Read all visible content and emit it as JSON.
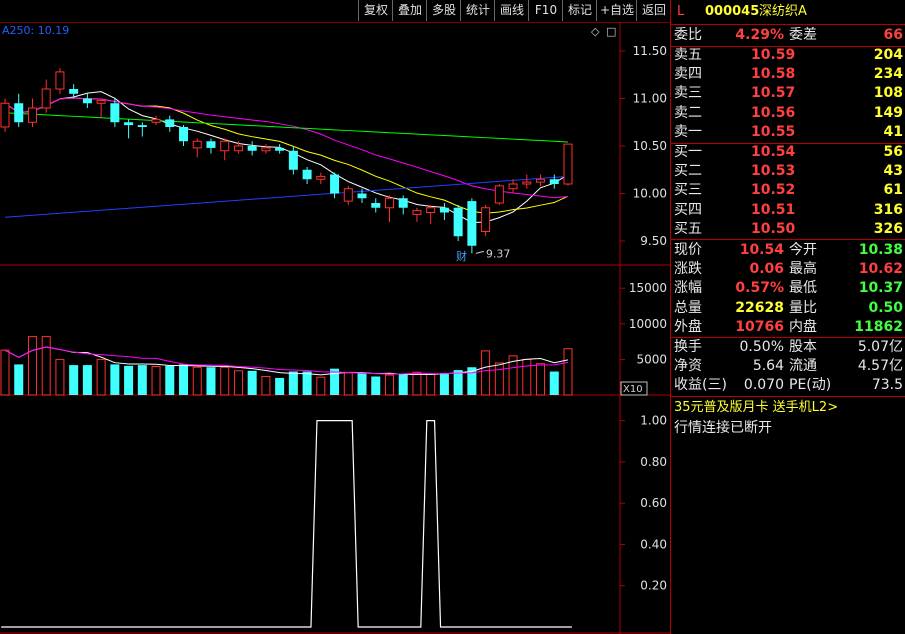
{
  "toolbar": {
    "buttons": [
      "复权",
      "叠加",
      "多股",
      "统计",
      "画线",
      "F10",
      "标记",
      "+自选",
      "返回"
    ]
  },
  "chart": {
    "ma_label": "A250: 10.19",
    "diamond_icon": "◇",
    "square_icon": "□",
    "price_ticks": [
      "11.50",
      "11.00",
      "10.50",
      "10.00",
      "9.50"
    ],
    "volume_ticks": [
      "15000",
      "10000",
      "5000"
    ],
    "indicator_ticks": [
      "1.00",
      "0.80",
      "0.60",
      "0.40",
      "0.20"
    ],
    "low_label": "9.37",
    "cai_badge": "财",
    "vol_unit": "X10",
    "colors": {
      "up": "#ff3030",
      "down": "#40ffff",
      "grid": "#b00000",
      "ma5": "#ffffff",
      "ma10": "#ffff00",
      "ma20": "#ff00ff",
      "ma60": "#00ff00",
      "ma250": "#2040ff",
      "ma_vol": "#ffff00"
    }
  },
  "chart_data": {
    "type": "candlestick",
    "candles": [
      {
        "o": 10.7,
        "c": 10.95,
        "h": 11.0,
        "l": 10.65
      },
      {
        "o": 10.95,
        "c": 10.75,
        "h": 11.05,
        "l": 10.7
      },
      {
        "o": 10.75,
        "c": 10.9,
        "h": 11.0,
        "l": 10.7
      },
      {
        "o": 10.9,
        "c": 11.1,
        "h": 11.2,
        "l": 10.85
      },
      {
        "o": 11.1,
        "c": 11.28,
        "h": 11.32,
        "l": 11.05
      },
      {
        "o": 11.1,
        "c": 11.05,
        "h": 11.15,
        "l": 11.0
      },
      {
        "o": 11.0,
        "c": 10.95,
        "h": 11.05,
        "l": 10.9
      },
      {
        "o": 10.95,
        "c": 10.98,
        "h": 11.0,
        "l": 10.8
      },
      {
        "o": 10.95,
        "c": 10.75,
        "h": 11.0,
        "l": 10.7
      },
      {
        "o": 10.75,
        "c": 10.72,
        "h": 10.78,
        "l": 10.58
      },
      {
        "o": 10.72,
        "c": 10.7,
        "h": 10.75,
        "l": 10.6
      },
      {
        "o": 10.75,
        "c": 10.78,
        "h": 10.82,
        "l": 10.72
      },
      {
        "o": 10.78,
        "c": 10.7,
        "h": 10.82,
        "l": 10.65
      },
      {
        "o": 10.7,
        "c": 10.55,
        "h": 10.72,
        "l": 10.5
      },
      {
        "o": 10.48,
        "c": 10.55,
        "h": 10.58,
        "l": 10.38
      },
      {
        "o": 10.55,
        "c": 10.48,
        "h": 10.58,
        "l": 10.42
      },
      {
        "o": 10.45,
        "c": 10.55,
        "h": 10.58,
        "l": 10.35
      },
      {
        "o": 10.45,
        "c": 10.5,
        "h": 10.55,
        "l": 10.42
      },
      {
        "o": 10.5,
        "c": 10.45,
        "h": 10.55,
        "l": 10.4
      },
      {
        "o": 10.45,
        "c": 10.48,
        "h": 10.52,
        "l": 10.42
      },
      {
        "o": 10.48,
        "c": 10.45,
        "h": 10.52,
        "l": 10.42
      },
      {
        "o": 10.45,
        "c": 10.25,
        "h": 10.5,
        "l": 10.2
      },
      {
        "o": 10.25,
        "c": 10.15,
        "h": 10.28,
        "l": 10.1
      },
      {
        "o": 10.15,
        "c": 10.18,
        "h": 10.22,
        "l": 10.1
      },
      {
        "o": 10.2,
        "c": 10.0,
        "h": 10.22,
        "l": 9.95
      },
      {
        "o": 9.92,
        "c": 10.05,
        "h": 10.08,
        "l": 9.88
      },
      {
        "o": 10.0,
        "c": 9.95,
        "h": 10.05,
        "l": 9.9
      },
      {
        "o": 9.9,
        "c": 9.85,
        "h": 9.95,
        "l": 9.8
      },
      {
        "o": 9.85,
        "c": 9.95,
        "h": 9.98,
        "l": 9.7
      },
      {
        "o": 9.95,
        "c": 9.85,
        "h": 9.98,
        "l": 9.78
      },
      {
        "o": 9.78,
        "c": 9.82,
        "h": 9.85,
        "l": 9.7
      },
      {
        "o": 9.8,
        "c": 9.85,
        "h": 9.88,
        "l": 9.68
      },
      {
        "o": 9.85,
        "c": 9.8,
        "h": 9.9,
        "l": 9.72
      },
      {
        "o": 9.85,
        "c": 9.55,
        "h": 9.88,
        "l": 9.5
      },
      {
        "o": 9.92,
        "c": 9.45,
        "h": 9.95,
        "l": 9.37
      },
      {
        "o": 9.6,
        "c": 9.85,
        "h": 9.88,
        "l": 9.55
      },
      {
        "o": 9.9,
        "c": 10.08,
        "h": 10.1,
        "l": 9.88
      },
      {
        "o": 10.05,
        "c": 10.1,
        "h": 10.15,
        "l": 10.0
      },
      {
        "o": 10.1,
        "c": 10.12,
        "h": 10.2,
        "l": 10.05
      },
      {
        "o": 10.12,
        "c": 10.15,
        "h": 10.2,
        "l": 10.08
      },
      {
        "o": 10.15,
        "c": 10.1,
        "h": 10.2,
        "l": 10.05
      },
      {
        "o": 10.1,
        "c": 10.52,
        "h": 10.52,
        "l": 10.08
      }
    ],
    "volumes": [
      6300,
      4300,
      8200,
      8200,
      5000,
      4200,
      4200,
      5000,
      4300,
      4100,
      4200,
      4000,
      4100,
      4300,
      3900,
      3900,
      3900,
      3400,
      3400,
      2600,
      2400,
      3300,
      3300,
      2500,
      3700,
      3100,
      3100,
      2600,
      2800,
      2900,
      3200,
      2900,
      3100,
      3500,
      3900,
      6200,
      4500,
      5500,
      5000,
      4400,
      3300,
      6500
    ],
    "indicator": [
      0,
      0,
      0,
      0,
      0,
      0,
      0,
      0,
      0,
      0,
      0,
      0,
      0,
      0,
      0,
      0,
      0,
      0,
      0,
      0,
      0,
      0,
      0,
      1,
      1,
      1,
      0,
      0,
      0,
      0,
      0,
      1,
      0,
      0,
      0,
      0,
      0,
      0,
      0,
      0,
      0,
      0
    ],
    "price_ylim": [
      9.3,
      11.7
    ],
    "volume_ylim": [
      0,
      17000
    ],
    "indicator_ylim": [
      0,
      1.1
    ]
  },
  "panel": {
    "header": {
      "flag": "L",
      "code": "000045",
      "name": "深纺织A"
    },
    "webi": {
      "label": "委比",
      "value": "4.29%",
      "label2": "委差",
      "value2": "66"
    },
    "asks": [
      {
        "label": "卖五",
        "price": "10.59",
        "vol": "204"
      },
      {
        "label": "卖四",
        "price": "10.58",
        "vol": "234"
      },
      {
        "label": "卖三",
        "price": "10.57",
        "vol": "108"
      },
      {
        "label": "卖二",
        "price": "10.56",
        "vol": "149"
      },
      {
        "label": "卖一",
        "price": "10.55",
        "vol": "41"
      }
    ],
    "bids": [
      {
        "label": "买一",
        "price": "10.54",
        "vol": "56"
      },
      {
        "label": "买二",
        "price": "10.53",
        "vol": "43"
      },
      {
        "label": "买三",
        "price": "10.52",
        "vol": "61"
      },
      {
        "label": "买四",
        "price": "10.51",
        "vol": "316"
      },
      {
        "label": "买五",
        "price": "10.50",
        "vol": "326"
      }
    ],
    "stats": [
      {
        "l1": "现价",
        "v1": "10.54",
        "c1": "red",
        "l2": "今开",
        "v2": "10.38",
        "c2": "grn"
      },
      {
        "l1": "涨跌",
        "v1": "0.06",
        "c1": "red",
        "l2": "最高",
        "v2": "10.62",
        "c2": "red"
      },
      {
        "l1": "涨幅",
        "v1": "0.57%",
        "c1": "red",
        "l2": "最低",
        "v2": "10.37",
        "c2": "grn"
      },
      {
        "l1": "总量",
        "v1": "22628",
        "c1": "yel",
        "l2": "量比",
        "v2": "0.50",
        "c2": "grn"
      },
      {
        "l1": "外盘",
        "v1": "10766",
        "c1": "red",
        "l2": "内盘",
        "v2": "11862",
        "c2": "grn"
      }
    ],
    "stats2": [
      {
        "l1": "换手",
        "v1": "0.50%",
        "l2": "股本",
        "v2": "5.07亿"
      },
      {
        "l1": "净资",
        "v1": "5.64",
        "l2": "流通",
        "v2": "4.57亿"
      },
      {
        "l1": "收益(三)",
        "v1": "0.070",
        "l2": "PE(动)",
        "v2": "73.5"
      }
    ],
    "promo": "35元普及版月卡 送手机L2>",
    "status": "行情连接已断开"
  }
}
